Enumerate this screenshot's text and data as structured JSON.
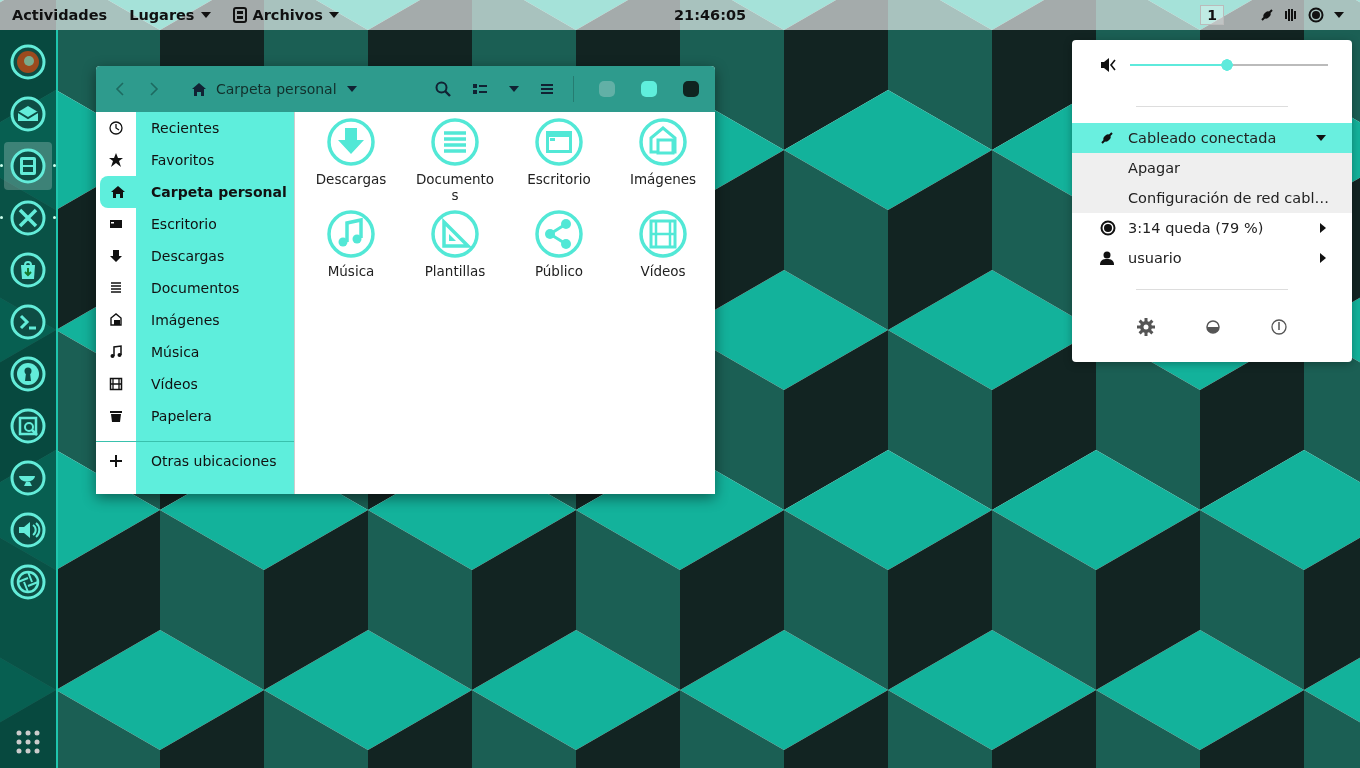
{
  "top_bar": {
    "activities": "Actividades",
    "places_menu": "Lugares",
    "app_menu": "Archivos",
    "clock": "21:46:05",
    "workspace": "1"
  },
  "dock": {
    "apps": [
      {
        "selected": false,
        "running": false
      },
      {
        "selected": false,
        "running": false
      },
      {
        "selected": true,
        "running": true
      },
      {
        "selected": false,
        "running": true
      },
      {
        "selected": false,
        "running": false
      },
      {
        "selected": false,
        "running": false
      },
      {
        "selected": false,
        "running": false
      },
      {
        "selected": false,
        "running": false
      },
      {
        "selected": false,
        "running": false
      },
      {
        "selected": false,
        "running": false
      },
      {
        "selected": false,
        "running": false
      }
    ]
  },
  "file_window": {
    "path": "Carpeta personal",
    "sidebar": [
      {
        "label": "Recientes",
        "selected": false
      },
      {
        "label": "Favoritos",
        "selected": false
      },
      {
        "label": "Carpeta personal",
        "selected": true
      },
      {
        "label": "Escritorio",
        "selected": false
      },
      {
        "label": "Descargas",
        "selected": false
      },
      {
        "label": "Documentos",
        "selected": false
      },
      {
        "label": "Imágenes",
        "selected": false
      },
      {
        "label": "Música",
        "selected": false
      },
      {
        "label": "Vídeos",
        "selected": false
      },
      {
        "label": "Papelera",
        "selected": false
      }
    ],
    "other_locations": "Otras ubicaciones",
    "folders": [
      "Descargas",
      "Documentos",
      "Escritorio",
      "Imágenes",
      "Música",
      "Plantillas",
      "Público",
      "Vídeos"
    ]
  },
  "system_menu": {
    "volume": {
      "level": 0.52
    },
    "network": {
      "label": "Cableado conectada",
      "expanded": true,
      "items": [
        "Apagar",
        "Configuración de red cabl…"
      ]
    },
    "battery": "3:14 queda (79 %)",
    "user": "usuario"
  }
}
